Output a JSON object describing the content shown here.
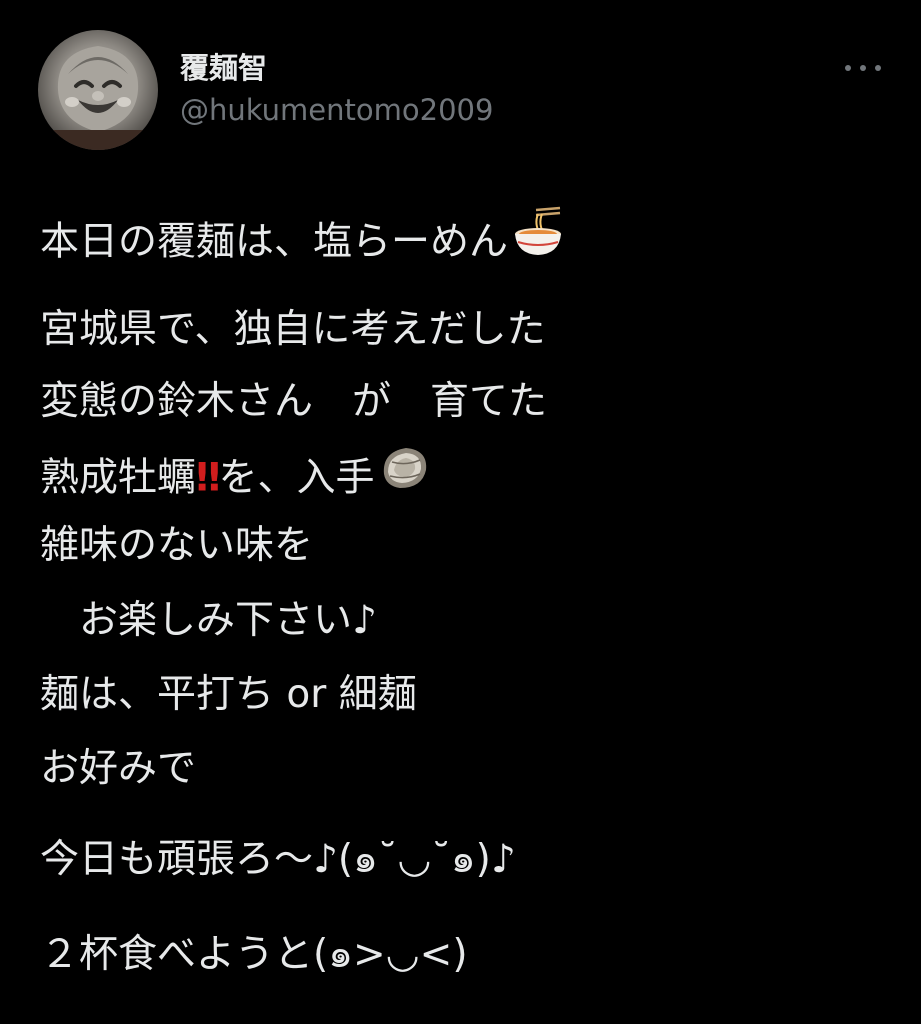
{
  "user": {
    "display_name": "覆麺智",
    "handle": "@hukumentomo2009"
  },
  "icons": {
    "avatar": "laughing-buddha-statue-avatar",
    "more": "more-options-icon",
    "ramen": "ramen-bowl-emoji",
    "oyster": "oyster-emoji",
    "double_exclamation": "double-exclamation-emoji"
  },
  "colors": {
    "background": "#000000",
    "text": "#e7e9ea",
    "secondary_text": "#71767b",
    "exclamation": "#d11d1d"
  },
  "tweet": {
    "line1": "本日の覆麺は、塩らーめん",
    "line2": "宮城県で、独自に考えだした",
    "line3": "変態の鈴木さん　が　育てた",
    "line4_a": "熟成牡蠣",
    "line4_bang": "‼",
    "line4_b": "を、入手",
    "line5": "雑味のない味を",
    "line6": "　お楽しみ下さい♪",
    "line7": "麺は、平打ち or 細麺",
    "line8": "お好みで",
    "line9": "今日も頑張ろ〜♪(๑˘◡˘๑)♪",
    "line10": "２杯食べようと(๑>◡<)"
  }
}
